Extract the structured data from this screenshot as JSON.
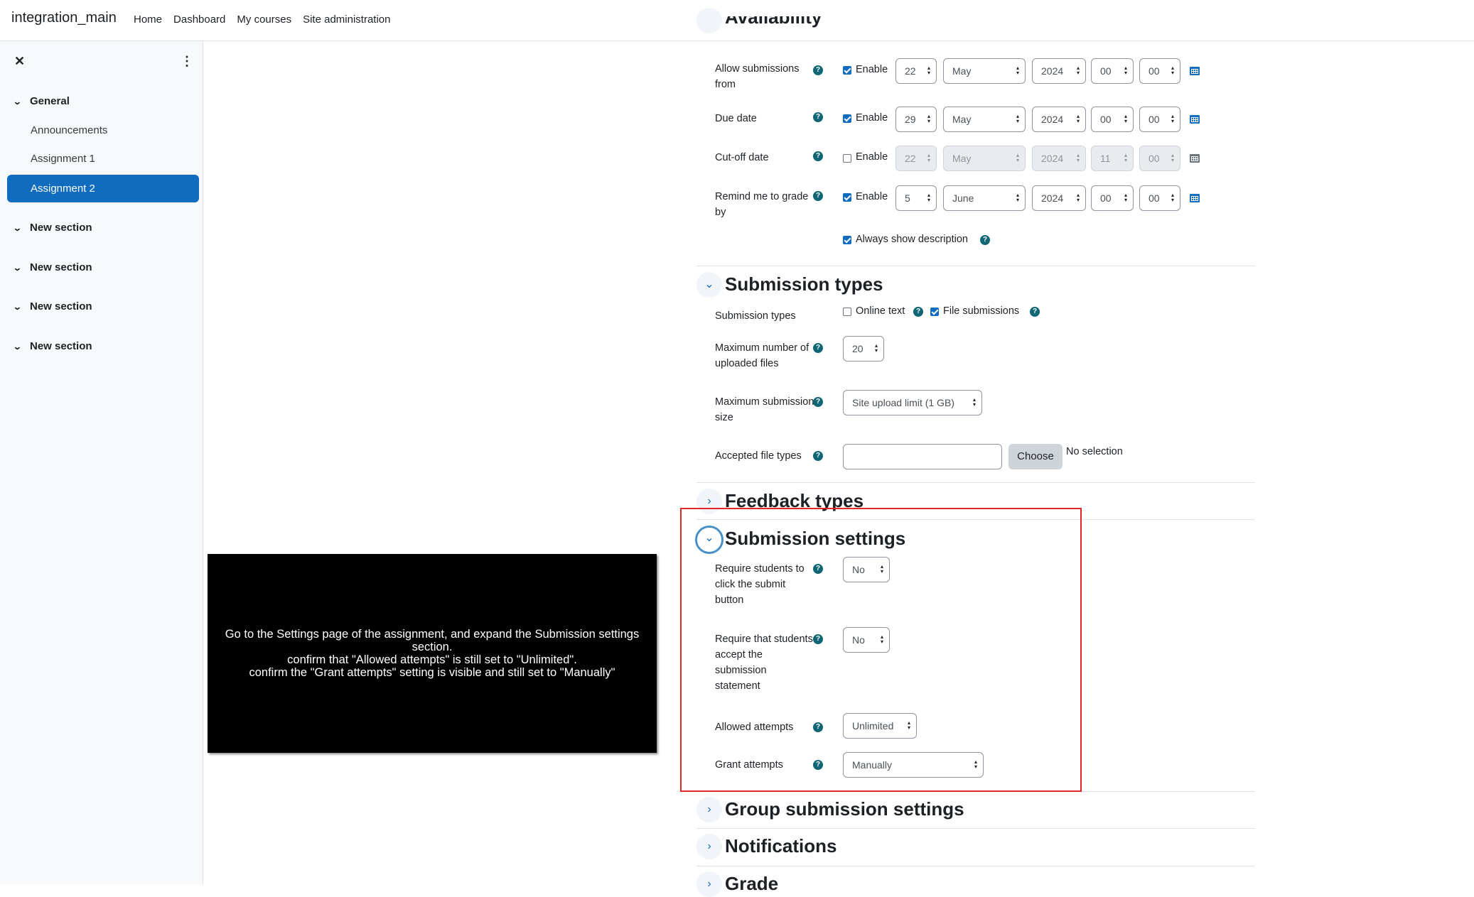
{
  "navbar": {
    "brand": "integration_main",
    "links": [
      "Home",
      "Dashboard",
      "My courses",
      "Site administration"
    ]
  },
  "drawer": {
    "close_icon": "close-icon",
    "menu_icon": "kebab-menu-icon",
    "sections": [
      {
        "title": "General",
        "activities": [
          "Announcements",
          "Assignment 1",
          "Assignment 2"
        ],
        "current": "Assignment 2"
      },
      {
        "title": "New section"
      },
      {
        "title": "New section"
      },
      {
        "title": "New section"
      },
      {
        "title": "New section"
      }
    ]
  },
  "availability": {
    "heading_partial": "Availability",
    "rows": [
      {
        "label": "Allow submissions from",
        "enabled": true,
        "enable_label": "Enable",
        "day": "22",
        "month": "May",
        "year": "2024",
        "hour": "00",
        "minute": "00",
        "disabled": false
      },
      {
        "label": "Due date",
        "enabled": true,
        "enable_label": "Enable",
        "day": "29",
        "month": "May",
        "year": "2024",
        "hour": "00",
        "minute": "00",
        "disabled": false
      },
      {
        "label": "Cut-off date",
        "enabled": false,
        "enable_label": "Enable",
        "day": "22",
        "month": "May",
        "year": "2024",
        "hour": "11",
        "minute": "00",
        "disabled": true
      },
      {
        "label": "Remind me to grade by",
        "enabled": true,
        "enable_label": "Enable",
        "day": "5",
        "month": "June",
        "year": "2024",
        "hour": "00",
        "minute": "00",
        "disabled": false
      }
    ],
    "always_show_description": {
      "label": "Always show description",
      "checked": true
    }
  },
  "submission_types": {
    "heading": "Submission types",
    "types_label": "Submission types",
    "online_text": {
      "label": "Online text",
      "checked": false
    },
    "file_submissions": {
      "label": "File submissions",
      "checked": true
    },
    "max_files_label": "Maximum number of uploaded files",
    "max_files_value": "20",
    "max_size_label": "Maximum submission size",
    "max_size_value": "Site upload limit (1 GB)",
    "accepted_types_label": "Accepted file types",
    "accepted_types_value": "",
    "choose_button": "Choose",
    "no_selection": "No selection"
  },
  "feedback_types": {
    "heading": "Feedback types"
  },
  "submission_settings": {
    "heading": "Submission settings",
    "require_submit_label": "Require students to click the submit button",
    "require_submit_value": "No",
    "require_statement_label": "Require that students accept the submission statement",
    "require_statement_value": "No",
    "allowed_attempts_label": "Allowed attempts",
    "allowed_attempts_value": "Unlimited",
    "grant_attempts_label": "Grant attempts",
    "grant_attempts_value": "Manually"
  },
  "collapsed_sections": [
    "Group submission settings",
    "Notifications",
    "Grade"
  ],
  "overlay": {
    "text": "Go to the Settings page of the assignment, and expand the Submission settings section.\nconfirm that \"Allowed attempts\" is still set to \"Unlimited\".\nconfirm the \"Grant attempts\" setting is visible and still set to \"Manually\""
  },
  "colors": {
    "primary": "#0f6cbf",
    "help": "#0f6674",
    "highlight": "#e0262b"
  }
}
